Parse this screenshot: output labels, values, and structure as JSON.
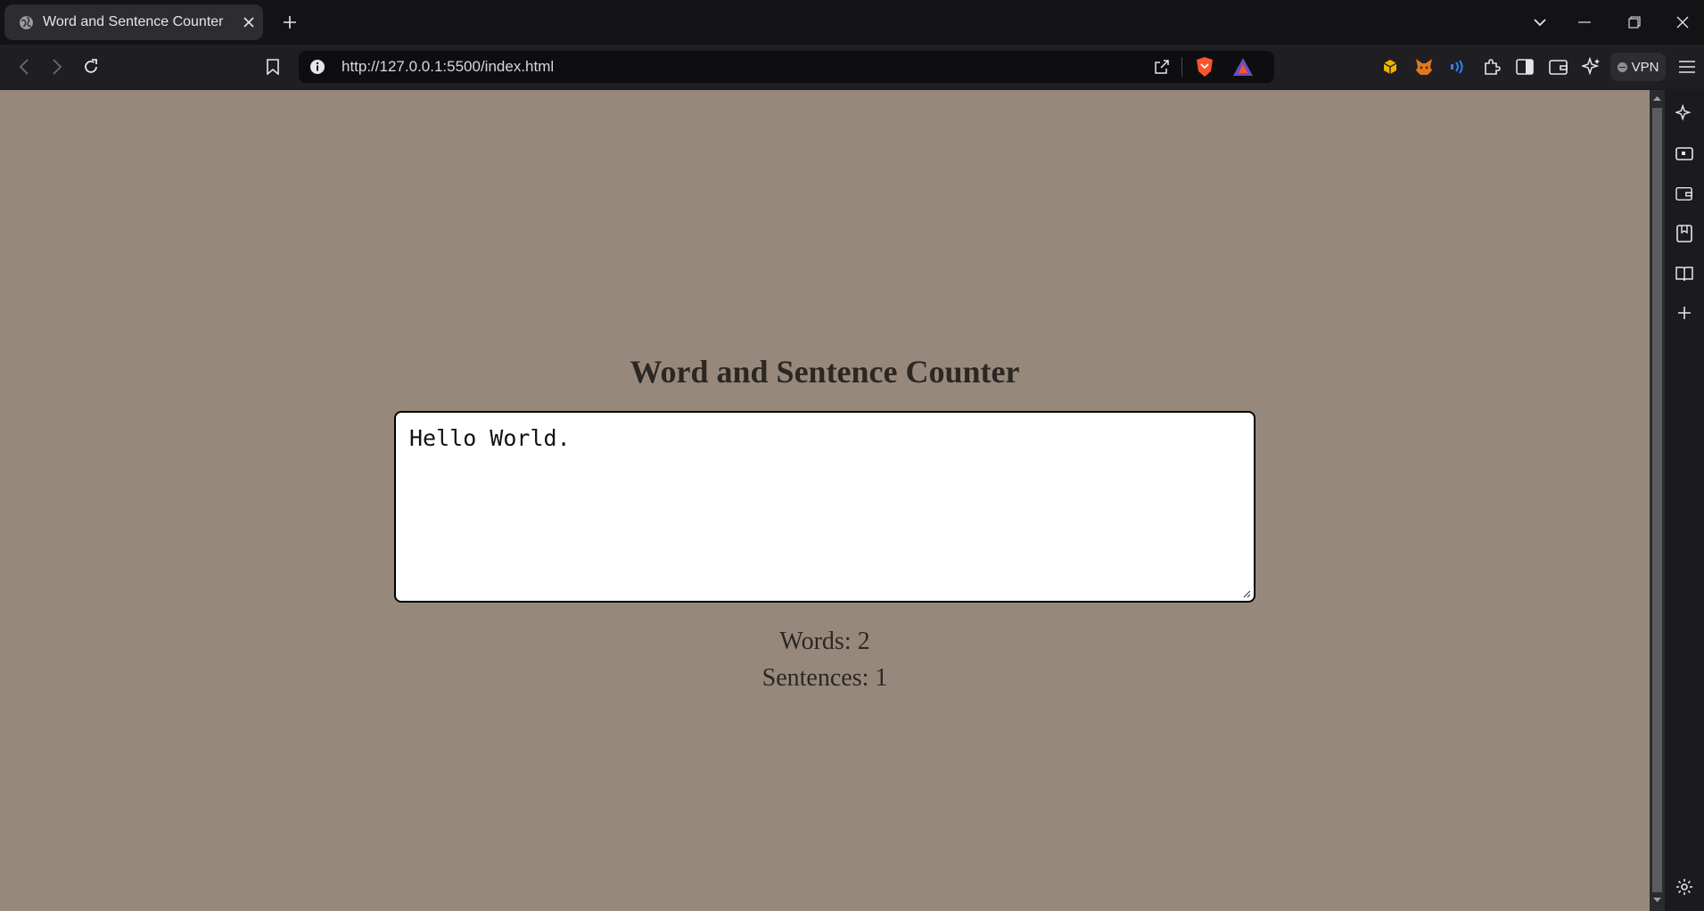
{
  "browser": {
    "tab": {
      "title": "Word and Sentence Counter"
    },
    "address_bar": {
      "url": "http://127.0.0.1:5500/index.html"
    },
    "vpn_label": "VPN",
    "accent_colors": {
      "brave": "#fb542b",
      "rewards": "#6b4fbb",
      "wallet": "#e2761b"
    }
  },
  "page": {
    "heading": "Word and Sentence Counter",
    "textarea_value": "Hello World.",
    "words_label": "Words: 2",
    "sentences_label": "Sentences: 1",
    "background_color": "#96897b"
  }
}
